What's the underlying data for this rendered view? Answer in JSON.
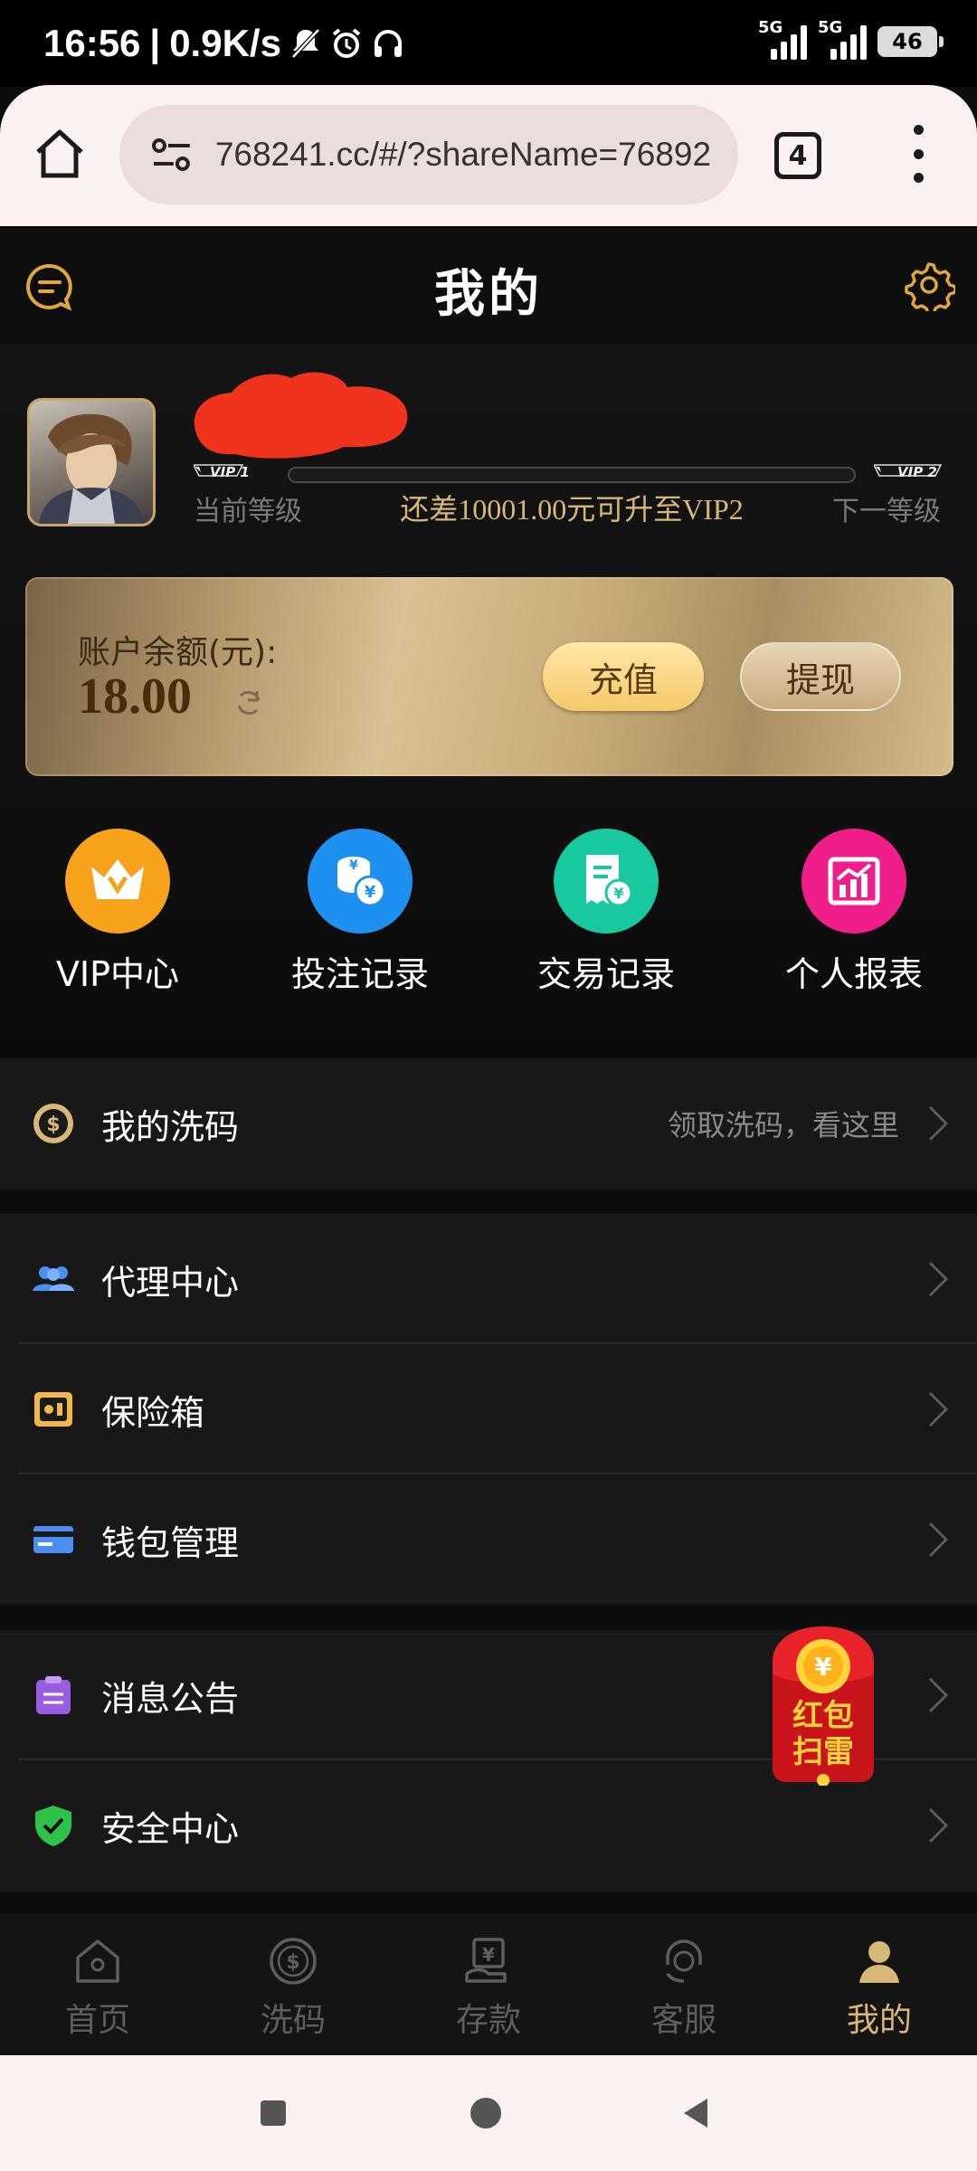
{
  "status_bar": {
    "time": "16:56",
    "speed": "0.9K/s",
    "network1": "5G",
    "network2": "5G",
    "battery": "46"
  },
  "browser": {
    "url": "768241.cc/#/?shareName=76892",
    "tab_count": "4"
  },
  "header": {
    "title": "我的"
  },
  "profile": {
    "vip_current_badge": "VIP 1",
    "vip_next_badge": "VIP 2",
    "current_level_label": "当前等级",
    "next_level_label": "下一等级",
    "upgrade_tip": "还差10001.00元可升至VIP2",
    "progress_fraction": 0
  },
  "balance": {
    "label": "账户余额(元):",
    "amount": "18.00",
    "recharge_label": "充值",
    "withdraw_label": "提现"
  },
  "quick_links": [
    {
      "label": "VIP中心",
      "icon": "vip-crown-icon",
      "color": "#f7a21b"
    },
    {
      "label": "投注记录",
      "icon": "coins-icon",
      "color": "#1e90f0"
    },
    {
      "label": "交易记录",
      "icon": "receipt-icon",
      "color": "#18c9a0"
    },
    {
      "label": "个人报表",
      "icon": "chart-icon",
      "color": "#ef1e8a"
    }
  ],
  "menu": {
    "wash": {
      "label": "我的洗码",
      "hint": "领取洗码，看这里"
    },
    "agent": {
      "label": "代理中心"
    },
    "safe": {
      "label": "保险箱"
    },
    "wallet": {
      "label": "钱包管理"
    },
    "notice": {
      "label": "消息公告"
    },
    "security": {
      "label": "安全中心"
    }
  },
  "red_packet": {
    "line1": "红包",
    "line2": "扫雷"
  },
  "tabbar": [
    {
      "label": "首页",
      "icon": "home-icon",
      "active": false
    },
    {
      "label": "洗码",
      "icon": "dollar-circle-icon",
      "active": false
    },
    {
      "label": "存款",
      "icon": "deposit-icon",
      "active": false
    },
    {
      "label": "客服",
      "icon": "support-icon",
      "active": false
    },
    {
      "label": "我的",
      "icon": "user-icon",
      "active": true
    }
  ],
  "colors": {
    "gold": "#d8b878",
    "background": "#0d0d0d",
    "row_bg": "#181818"
  }
}
